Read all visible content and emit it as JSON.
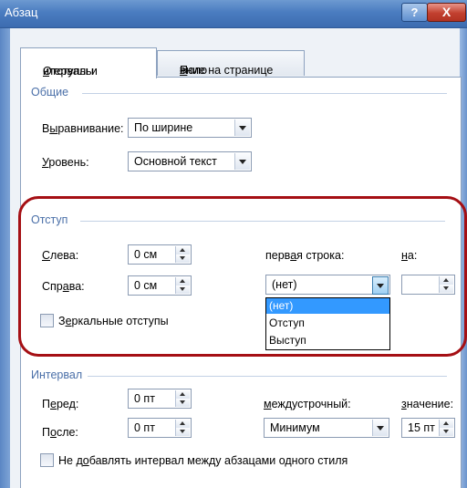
{
  "window": {
    "title": "Абзац",
    "help_glyph": "?",
    "close_glyph": "X"
  },
  "tabs": [
    {
      "pre": "Отступы и ",
      "u": "и",
      "post": "нтервалы"
    },
    {
      "pre": "Поло",
      "u": "ж",
      "post": "ение на странице"
    }
  ],
  "general": {
    "title": "Общие",
    "alignment": {
      "pre": "В",
      "u": "ы",
      "post": "равнивание:",
      "value": "По ширине"
    },
    "level": {
      "pre": "",
      "u": "У",
      "post": "ровень:",
      "value": "Основной текст"
    }
  },
  "indent": {
    "title": "Отступ",
    "left": {
      "pre": "",
      "u": "С",
      "post": "лева:",
      "value": "0 см"
    },
    "right": {
      "pre": "Спр",
      "u": "а",
      "post": "ва:",
      "value": "0 см"
    },
    "first_line": {
      "pre": "перв",
      "u": "а",
      "post": "я строка:",
      "value": "(нет)"
    },
    "by": {
      "pre": "",
      "u": "н",
      "post": "а:",
      "value": ""
    },
    "mirror": {
      "pre": "З",
      "u": "е",
      "post": "ркальные отступы"
    },
    "first_line_options": [
      "(нет)",
      "Отступ",
      "Выступ"
    ],
    "selected_option_index": 0
  },
  "spacing": {
    "title": "Интервал",
    "before": {
      "pre": "П",
      "u": "е",
      "post": "ред:",
      "value": "0 пт"
    },
    "after": {
      "pre": "П",
      "u": "о",
      "post": "сле:",
      "value": "0 пт"
    },
    "line": {
      "pre": "",
      "u": "м",
      "post": "еждустрочный:",
      "value": "Минимум"
    },
    "amount": {
      "pre": "",
      "u": "з",
      "post": "начение:",
      "value": "15 пт"
    },
    "no_space": {
      "pre": "Не д",
      "u": "о",
      "post": "бавлять интервал между абзацами одного стиля"
    }
  },
  "colors": {
    "titlebar": "#4a7cc0",
    "highlight_ring": "#a50f14",
    "section_title": "#4a6fa8",
    "list_selection": "#3399ff"
  }
}
